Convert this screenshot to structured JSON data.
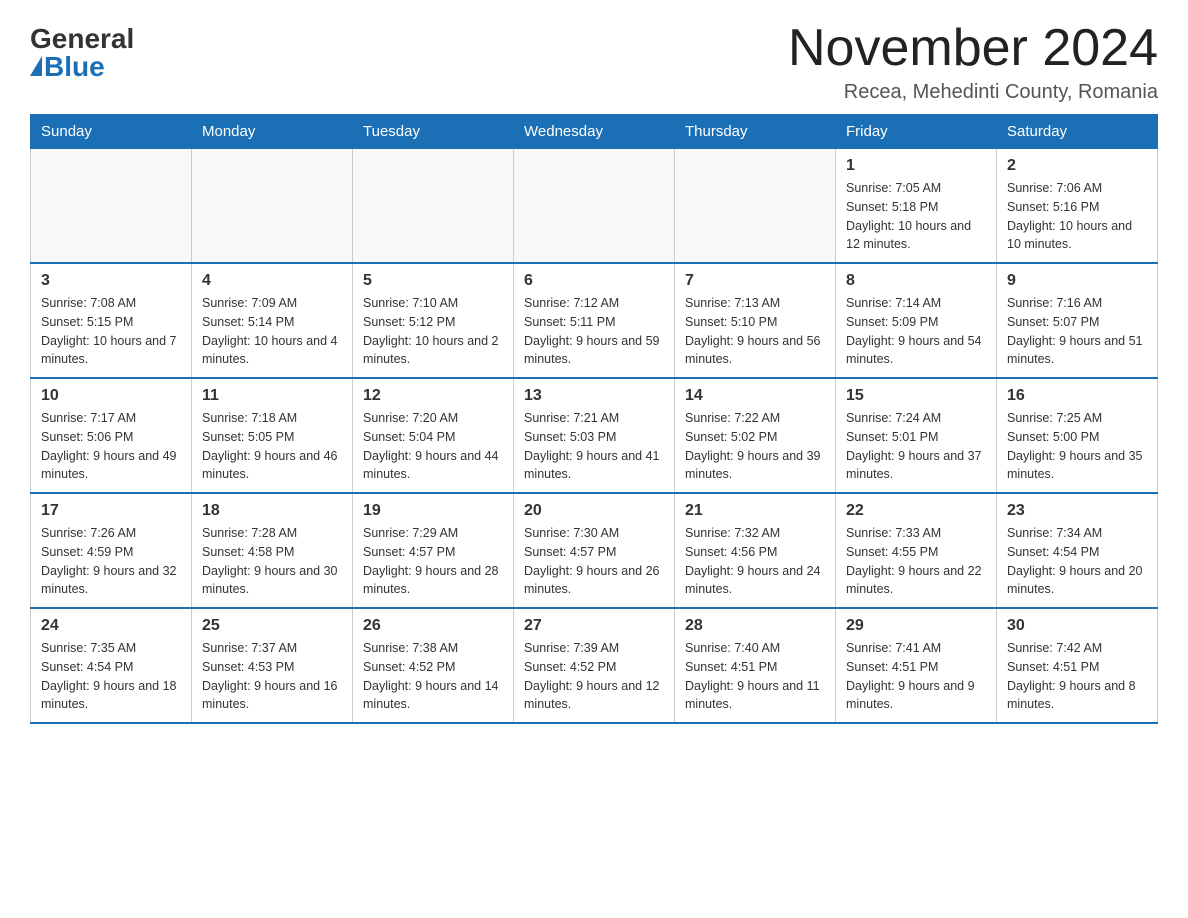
{
  "header": {
    "logo_general": "General",
    "logo_blue": "Blue",
    "title": "November 2024",
    "location": "Recea, Mehedinti County, Romania"
  },
  "weekdays": [
    "Sunday",
    "Monday",
    "Tuesday",
    "Wednesday",
    "Thursday",
    "Friday",
    "Saturday"
  ],
  "weeks": [
    [
      {
        "day": "",
        "sunrise": "",
        "sunset": "",
        "daylight": "",
        "empty": true
      },
      {
        "day": "",
        "sunrise": "",
        "sunset": "",
        "daylight": "",
        "empty": true
      },
      {
        "day": "",
        "sunrise": "",
        "sunset": "",
        "daylight": "",
        "empty": true
      },
      {
        "day": "",
        "sunrise": "",
        "sunset": "",
        "daylight": "",
        "empty": true
      },
      {
        "day": "",
        "sunrise": "",
        "sunset": "",
        "daylight": "",
        "empty": true
      },
      {
        "day": "1",
        "sunrise": "Sunrise: 7:05 AM",
        "sunset": "Sunset: 5:18 PM",
        "daylight": "Daylight: 10 hours and 12 minutes.",
        "empty": false
      },
      {
        "day": "2",
        "sunrise": "Sunrise: 7:06 AM",
        "sunset": "Sunset: 5:16 PM",
        "daylight": "Daylight: 10 hours and 10 minutes.",
        "empty": false
      }
    ],
    [
      {
        "day": "3",
        "sunrise": "Sunrise: 7:08 AM",
        "sunset": "Sunset: 5:15 PM",
        "daylight": "Daylight: 10 hours and 7 minutes.",
        "empty": false
      },
      {
        "day": "4",
        "sunrise": "Sunrise: 7:09 AM",
        "sunset": "Sunset: 5:14 PM",
        "daylight": "Daylight: 10 hours and 4 minutes.",
        "empty": false
      },
      {
        "day": "5",
        "sunrise": "Sunrise: 7:10 AM",
        "sunset": "Sunset: 5:12 PM",
        "daylight": "Daylight: 10 hours and 2 minutes.",
        "empty": false
      },
      {
        "day": "6",
        "sunrise": "Sunrise: 7:12 AM",
        "sunset": "Sunset: 5:11 PM",
        "daylight": "Daylight: 9 hours and 59 minutes.",
        "empty": false
      },
      {
        "day": "7",
        "sunrise": "Sunrise: 7:13 AM",
        "sunset": "Sunset: 5:10 PM",
        "daylight": "Daylight: 9 hours and 56 minutes.",
        "empty": false
      },
      {
        "day": "8",
        "sunrise": "Sunrise: 7:14 AM",
        "sunset": "Sunset: 5:09 PM",
        "daylight": "Daylight: 9 hours and 54 minutes.",
        "empty": false
      },
      {
        "day": "9",
        "sunrise": "Sunrise: 7:16 AM",
        "sunset": "Sunset: 5:07 PM",
        "daylight": "Daylight: 9 hours and 51 minutes.",
        "empty": false
      }
    ],
    [
      {
        "day": "10",
        "sunrise": "Sunrise: 7:17 AM",
        "sunset": "Sunset: 5:06 PM",
        "daylight": "Daylight: 9 hours and 49 minutes.",
        "empty": false
      },
      {
        "day": "11",
        "sunrise": "Sunrise: 7:18 AM",
        "sunset": "Sunset: 5:05 PM",
        "daylight": "Daylight: 9 hours and 46 minutes.",
        "empty": false
      },
      {
        "day": "12",
        "sunrise": "Sunrise: 7:20 AM",
        "sunset": "Sunset: 5:04 PM",
        "daylight": "Daylight: 9 hours and 44 minutes.",
        "empty": false
      },
      {
        "day": "13",
        "sunrise": "Sunrise: 7:21 AM",
        "sunset": "Sunset: 5:03 PM",
        "daylight": "Daylight: 9 hours and 41 minutes.",
        "empty": false
      },
      {
        "day": "14",
        "sunrise": "Sunrise: 7:22 AM",
        "sunset": "Sunset: 5:02 PM",
        "daylight": "Daylight: 9 hours and 39 minutes.",
        "empty": false
      },
      {
        "day": "15",
        "sunrise": "Sunrise: 7:24 AM",
        "sunset": "Sunset: 5:01 PM",
        "daylight": "Daylight: 9 hours and 37 minutes.",
        "empty": false
      },
      {
        "day": "16",
        "sunrise": "Sunrise: 7:25 AM",
        "sunset": "Sunset: 5:00 PM",
        "daylight": "Daylight: 9 hours and 35 minutes.",
        "empty": false
      }
    ],
    [
      {
        "day": "17",
        "sunrise": "Sunrise: 7:26 AM",
        "sunset": "Sunset: 4:59 PM",
        "daylight": "Daylight: 9 hours and 32 minutes.",
        "empty": false
      },
      {
        "day": "18",
        "sunrise": "Sunrise: 7:28 AM",
        "sunset": "Sunset: 4:58 PM",
        "daylight": "Daylight: 9 hours and 30 minutes.",
        "empty": false
      },
      {
        "day": "19",
        "sunrise": "Sunrise: 7:29 AM",
        "sunset": "Sunset: 4:57 PM",
        "daylight": "Daylight: 9 hours and 28 minutes.",
        "empty": false
      },
      {
        "day": "20",
        "sunrise": "Sunrise: 7:30 AM",
        "sunset": "Sunset: 4:57 PM",
        "daylight": "Daylight: 9 hours and 26 minutes.",
        "empty": false
      },
      {
        "day": "21",
        "sunrise": "Sunrise: 7:32 AM",
        "sunset": "Sunset: 4:56 PM",
        "daylight": "Daylight: 9 hours and 24 minutes.",
        "empty": false
      },
      {
        "day": "22",
        "sunrise": "Sunrise: 7:33 AM",
        "sunset": "Sunset: 4:55 PM",
        "daylight": "Daylight: 9 hours and 22 minutes.",
        "empty": false
      },
      {
        "day": "23",
        "sunrise": "Sunrise: 7:34 AM",
        "sunset": "Sunset: 4:54 PM",
        "daylight": "Daylight: 9 hours and 20 minutes.",
        "empty": false
      }
    ],
    [
      {
        "day": "24",
        "sunrise": "Sunrise: 7:35 AM",
        "sunset": "Sunset: 4:54 PM",
        "daylight": "Daylight: 9 hours and 18 minutes.",
        "empty": false
      },
      {
        "day": "25",
        "sunrise": "Sunrise: 7:37 AM",
        "sunset": "Sunset: 4:53 PM",
        "daylight": "Daylight: 9 hours and 16 minutes.",
        "empty": false
      },
      {
        "day": "26",
        "sunrise": "Sunrise: 7:38 AM",
        "sunset": "Sunset: 4:52 PM",
        "daylight": "Daylight: 9 hours and 14 minutes.",
        "empty": false
      },
      {
        "day": "27",
        "sunrise": "Sunrise: 7:39 AM",
        "sunset": "Sunset: 4:52 PM",
        "daylight": "Daylight: 9 hours and 12 minutes.",
        "empty": false
      },
      {
        "day": "28",
        "sunrise": "Sunrise: 7:40 AM",
        "sunset": "Sunset: 4:51 PM",
        "daylight": "Daylight: 9 hours and 11 minutes.",
        "empty": false
      },
      {
        "day": "29",
        "sunrise": "Sunrise: 7:41 AM",
        "sunset": "Sunset: 4:51 PM",
        "daylight": "Daylight: 9 hours and 9 minutes.",
        "empty": false
      },
      {
        "day": "30",
        "sunrise": "Sunrise: 7:42 AM",
        "sunset": "Sunset: 4:51 PM",
        "daylight": "Daylight: 9 hours and 8 minutes.",
        "empty": false
      }
    ]
  ]
}
